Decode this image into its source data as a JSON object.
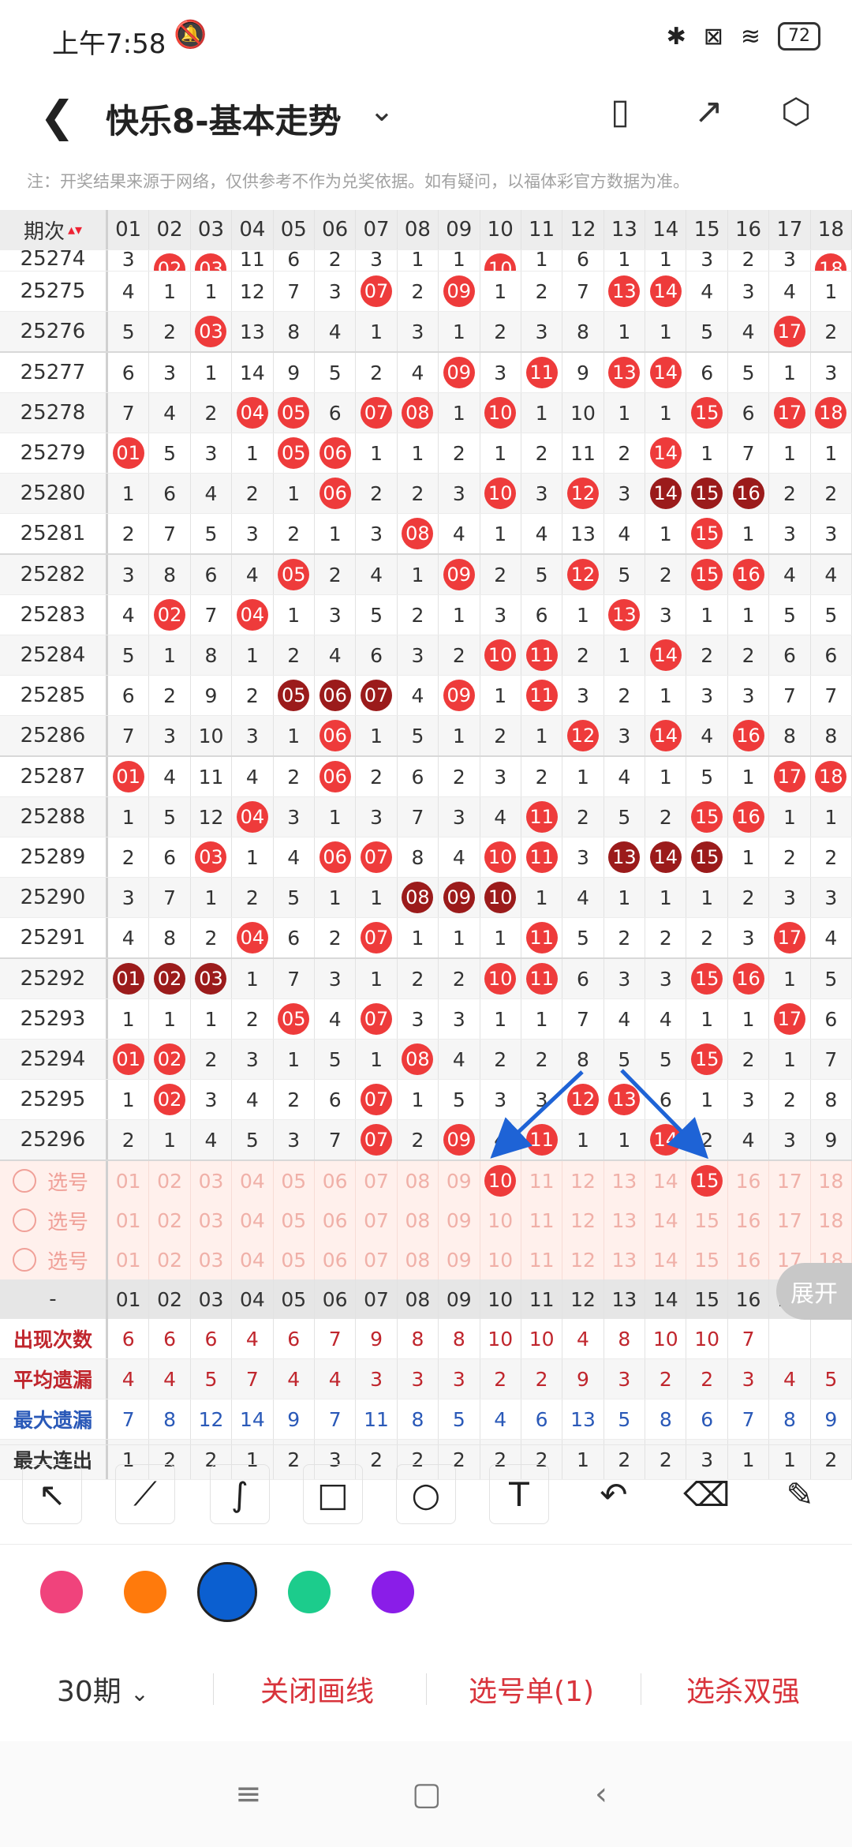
{
  "status": {
    "time": "上午7:58",
    "battery": "72"
  },
  "header": {
    "title": "快乐8-基本走势"
  },
  "notice": "注：开奖结果来源于网络，仅供参考不作为兑奖依据。如有疑问，以福体彩官方数据为准。",
  "grid": {
    "id_header": "期次",
    "columns": [
      "01",
      "02",
      "03",
      "04",
      "05",
      "06",
      "07",
      "08",
      "09",
      "10",
      "11",
      "12",
      "13",
      "14",
      "15",
      "16",
      "17",
      "18"
    ],
    "partial_top": [
      "3",
      "02",
      "03",
      "11",
      "6",
      "2",
      "3",
      "1",
      "1",
      "10",
      "1",
      "6",
      "1",
      "1",
      "3",
      "2",
      "3",
      "18"
    ],
    "rows": [
      {
        "id": "25275",
        "c": [
          "4",
          "1",
          "1",
          "12",
          "7",
          "3",
          "07",
          "2",
          "09",
          "1",
          "2",
          "7",
          "13",
          "14",
          "4",
          "3",
          "4",
          "1"
        ]
      },
      {
        "id": "25276",
        "c": [
          "5",
          "2",
          "03",
          "13",
          "8",
          "4",
          "1",
          "3",
          "1",
          "2",
          "3",
          "8",
          "1",
          "1",
          "5",
          "4",
          "17",
          "2"
        ]
      },
      {
        "id": "25277",
        "c": [
          "6",
          "3",
          "1",
          "14",
          "9",
          "5",
          "2",
          "4",
          "09",
          "3",
          "11",
          "9",
          "13",
          "14",
          "6",
          "5",
          "1",
          "3"
        ]
      },
      {
        "id": "25278",
        "c": [
          "7",
          "4",
          "2",
          "04",
          "05",
          "6",
          "07",
          "08",
          "1",
          "10",
          "1",
          "10",
          "1",
          "1",
          "15",
          "6",
          "17",
          "18"
        ]
      },
      {
        "id": "25279",
        "c": [
          "01",
          "5",
          "3",
          "1",
          "05",
          "06",
          "1",
          "1",
          "2",
          "1",
          "2",
          "11",
          "2",
          "14",
          "1",
          "7",
          "1",
          "1"
        ]
      },
      {
        "id": "25280",
        "c": [
          "1",
          "6",
          "4",
          "2",
          "1",
          "06",
          "2",
          "2",
          "3",
          "10",
          "3",
          "12",
          "3",
          "14",
          "15",
          "16",
          "2",
          "2"
        ]
      },
      {
        "id": "25281",
        "c": [
          "2",
          "7",
          "5",
          "3",
          "2",
          "1",
          "3",
          "08",
          "4",
          "1",
          "4",
          "13",
          "4",
          "1",
          "15",
          "1",
          "3",
          "3"
        ]
      },
      {
        "id": "25282",
        "c": [
          "3",
          "8",
          "6",
          "4",
          "05",
          "2",
          "4",
          "1",
          "09",
          "2",
          "5",
          "12",
          "5",
          "2",
          "15",
          "16",
          "4",
          "4"
        ]
      },
      {
        "id": "25283",
        "c": [
          "4",
          "02",
          "7",
          "04",
          "1",
          "3",
          "5",
          "2",
          "1",
          "3",
          "6",
          "1",
          "13",
          "3",
          "1",
          "1",
          "5",
          "5"
        ]
      },
      {
        "id": "25284",
        "c": [
          "5",
          "1",
          "8",
          "1",
          "2",
          "4",
          "6",
          "3",
          "2",
          "10",
          "11",
          "2",
          "1",
          "14",
          "2",
          "2",
          "6",
          "6"
        ]
      },
      {
        "id": "25285",
        "c": [
          "6",
          "2",
          "9",
          "2",
          "05",
          "06",
          "07",
          "4",
          "09",
          "1",
          "11",
          "3",
          "2",
          "1",
          "3",
          "3",
          "7",
          "7"
        ]
      },
      {
        "id": "25286",
        "c": [
          "7",
          "3",
          "10",
          "3",
          "1",
          "06",
          "1",
          "5",
          "1",
          "2",
          "1",
          "12",
          "3",
          "14",
          "4",
          "16",
          "8",
          "8"
        ]
      },
      {
        "id": "25287",
        "c": [
          "01",
          "4",
          "11",
          "4",
          "2",
          "06",
          "2",
          "6",
          "2",
          "3",
          "2",
          "1",
          "4",
          "1",
          "5",
          "1",
          "17",
          "18"
        ]
      },
      {
        "id": "25288",
        "c": [
          "1",
          "5",
          "12",
          "04",
          "3",
          "1",
          "3",
          "7",
          "3",
          "4",
          "11",
          "2",
          "5",
          "2",
          "15",
          "16",
          "1",
          "1"
        ]
      },
      {
        "id": "25289",
        "c": [
          "2",
          "6",
          "03",
          "1",
          "4",
          "06",
          "07",
          "8",
          "4",
          "10",
          "11",
          "3",
          "13",
          "14",
          "15",
          "1",
          "2",
          "2"
        ]
      },
      {
        "id": "25290",
        "c": [
          "3",
          "7",
          "1",
          "2",
          "5",
          "1",
          "1",
          "08",
          "09",
          "10",
          "1",
          "4",
          "1",
          "1",
          "1",
          "2",
          "3",
          "3"
        ]
      },
      {
        "id": "25291",
        "c": [
          "4",
          "8",
          "2",
          "04",
          "6",
          "2",
          "07",
          "1",
          "1",
          "1",
          "11",
          "5",
          "2",
          "2",
          "2",
          "3",
          "17",
          "4"
        ]
      },
      {
        "id": "25292",
        "c": [
          "01",
          "02",
          "03",
          "1",
          "7",
          "3",
          "1",
          "2",
          "2",
          "10",
          "11",
          "6",
          "3",
          "3",
          "15",
          "16",
          "1",
          "5"
        ]
      },
      {
        "id": "25293",
        "c": [
          "1",
          "1",
          "1",
          "2",
          "05",
          "4",
          "07",
          "3",
          "3",
          "1",
          "1",
          "7",
          "4",
          "4",
          "1",
          "1",
          "17",
          "6"
        ]
      },
      {
        "id": "25294",
        "c": [
          "01",
          "02",
          "2",
          "3",
          "1",
          "5",
          "1",
          "08",
          "4",
          "2",
          "2",
          "8",
          "5",
          "5",
          "15",
          "2",
          "1",
          "7"
        ]
      },
      {
        "id": "25295",
        "c": [
          "1",
          "02",
          "3",
          "4",
          "2",
          "6",
          "07",
          "1",
          "5",
          "3",
          "3",
          "12",
          "13",
          "6",
          "1",
          "3",
          "2",
          "8"
        ]
      },
      {
        "id": "25296",
        "c": [
          "2",
          "1",
          "4",
          "5",
          "3",
          "7",
          "07",
          "2",
          "09",
          "4",
          "11",
          "1",
          "1",
          "14",
          "2",
          "4",
          "3",
          "9"
        ]
      }
    ],
    "pick_label": "选号",
    "pick_rows": [
      {
        "selected": [
          "10",
          "15"
        ]
      },
      {
        "selected": []
      },
      {
        "selected": []
      }
    ],
    "sep_label": "-",
    "stats": [
      {
        "label": "出现次数",
        "kind": "red",
        "values": [
          "6",
          "6",
          "6",
          "4",
          "6",
          "7",
          "9",
          "8",
          "8",
          "10",
          "10",
          "4",
          "8",
          "10",
          "10",
          "7",
          "",
          ""
        ]
      },
      {
        "label": "平均遗漏",
        "kind": "red",
        "values": [
          "4",
          "4",
          "5",
          "7",
          "4",
          "4",
          "3",
          "3",
          "3",
          "2",
          "2",
          "9",
          "3",
          "2",
          "2",
          "3",
          "4",
          "5"
        ]
      },
      {
        "label": "最大遗漏",
        "kind": "blue",
        "values": [
          "7",
          "8",
          "12",
          "14",
          "9",
          "7",
          "11",
          "8",
          "5",
          "4",
          "6",
          "13",
          "5",
          "8",
          "6",
          "7",
          "8",
          "9"
        ]
      },
      {
        "label": "最大连出",
        "kind": "dark",
        "values": [
          "1",
          "2",
          "2",
          "1",
          "2",
          "3",
          "2",
          "2",
          "2",
          "2",
          "2",
          "1",
          "2",
          "2",
          "3",
          "1",
          "1",
          "2"
        ]
      }
    ],
    "expand_label": "展开"
  },
  "tools": {
    "names": [
      "pointer-arrow-icon",
      "line-icon",
      "freehand-icon",
      "rectangle-icon",
      "circle-icon",
      "text-icon",
      "undo-icon",
      "eraser-icon",
      "brush-clear-icon"
    ]
  },
  "colors": [
    "#f0437c",
    "#ff7a0c",
    "#0b5fd0",
    "#1ccc8c",
    "#8a1de8"
  ],
  "selected_color": "#0b5fd0",
  "bottom": {
    "period": "30期",
    "close": "关闭画线",
    "picks": "选号单(1)",
    "kill": "选杀双强"
  },
  "dark_balls": {
    "25280": [
      "14",
      "15",
      "16"
    ],
    "25285": [
      "05",
      "06",
      "07"
    ],
    "25289": [
      "13",
      "14",
      "15"
    ],
    "25290": [
      "08",
      "09",
      "10"
    ],
    "25292": [
      "01",
      "02",
      "03"
    ]
  }
}
